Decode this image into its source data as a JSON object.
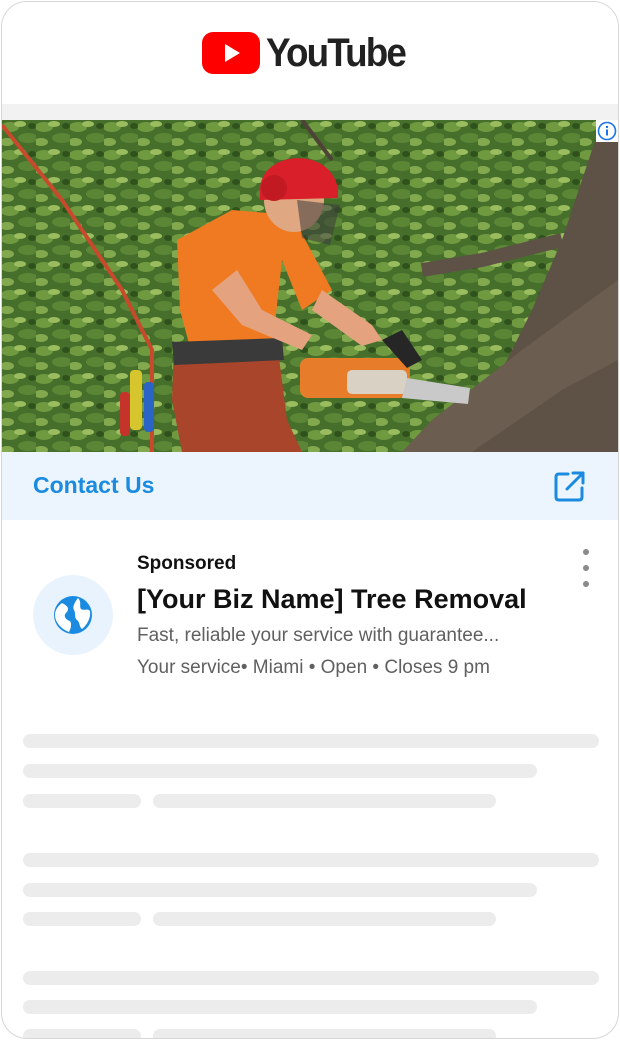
{
  "header": {
    "logo_text": "YouTube"
  },
  "ad": {
    "image": {
      "subject": "arborist cutting tree with chainsaw"
    },
    "cta_label": "Contact Us",
    "sponsored_label": "Sponsored",
    "title": "[Your Biz Name] Tree Removal",
    "description": "Fast, reliable your service with guarantee...",
    "meta": "Your service• Miami • Open • Closes 9 pm"
  },
  "colors": {
    "brand_red": "#ff0000",
    "cta_blue": "#1a8be0",
    "cta_background": "#ecf5fd",
    "placeholder": "#ececec"
  },
  "icons": [
    "youtube-play-icon",
    "info-icon",
    "external-link-icon",
    "globe-icon",
    "more-vert-icon"
  ]
}
